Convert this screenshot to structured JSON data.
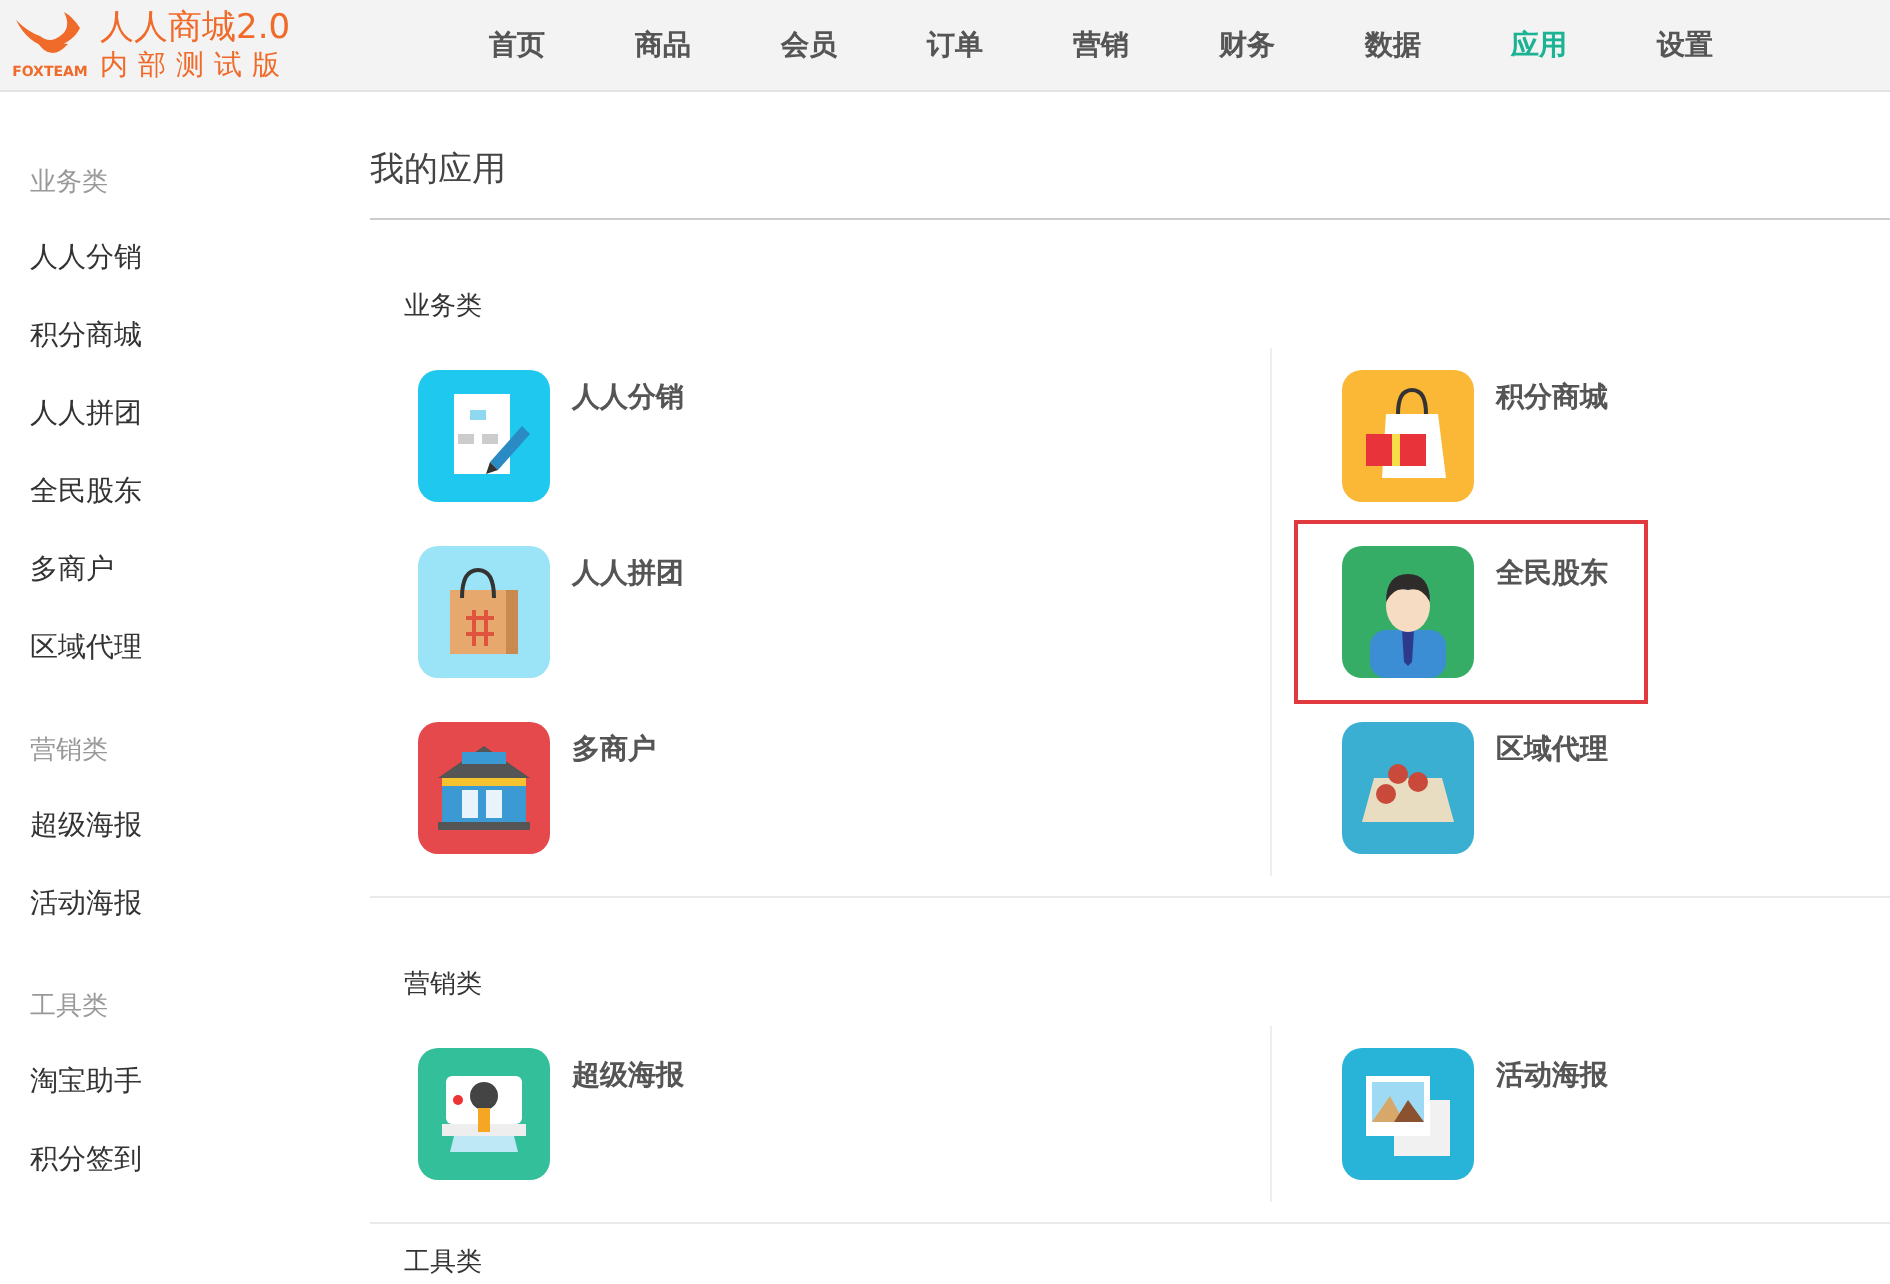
{
  "logo": {
    "title": "人人商城2.0",
    "subtitle": "内部测试版",
    "brand": "FOXTEAM"
  },
  "nav": [
    {
      "label": "首页",
      "selected": false
    },
    {
      "label": "商品",
      "selected": false
    },
    {
      "label": "会员",
      "selected": false
    },
    {
      "label": "订单",
      "selected": false
    },
    {
      "label": "营销",
      "selected": false
    },
    {
      "label": "财务",
      "selected": false
    },
    {
      "label": "数据",
      "selected": false
    },
    {
      "label": "应用",
      "selected": true
    },
    {
      "label": "设置",
      "selected": false
    }
  ],
  "sidebar": [
    {
      "heading": "业务类",
      "items": [
        "人人分销",
        "积分商城",
        "人人拼团",
        "全民股东",
        "多商户",
        "区域代理"
      ]
    },
    {
      "heading": "营销类",
      "items": [
        "超级海报",
        "活动海报"
      ]
    },
    {
      "heading": "工具类",
      "items": [
        "淘宝助手",
        "积分签到"
      ]
    }
  ],
  "page_title": "我的应用",
  "sections": [
    {
      "heading": "业务类",
      "apps": [
        {
          "name": "人人分销",
          "kind": "flowchart",
          "highlighted": false
        },
        {
          "name": "积分商城",
          "kind": "gift",
          "highlighted": false
        },
        {
          "name": "人人拼团",
          "kind": "bag",
          "highlighted": false
        },
        {
          "name": "全民股东",
          "kind": "person",
          "highlighted": true
        },
        {
          "name": "多商户",
          "kind": "store",
          "highlighted": false
        },
        {
          "name": "区域代理",
          "kind": "map",
          "highlighted": false
        }
      ]
    },
    {
      "heading": "营销类",
      "apps": [
        {
          "name": "超级海报",
          "kind": "camera",
          "highlighted": false
        },
        {
          "name": "活动海报",
          "kind": "photos",
          "highlighted": false
        }
      ]
    },
    {
      "heading": "工具类"
    }
  ]
}
